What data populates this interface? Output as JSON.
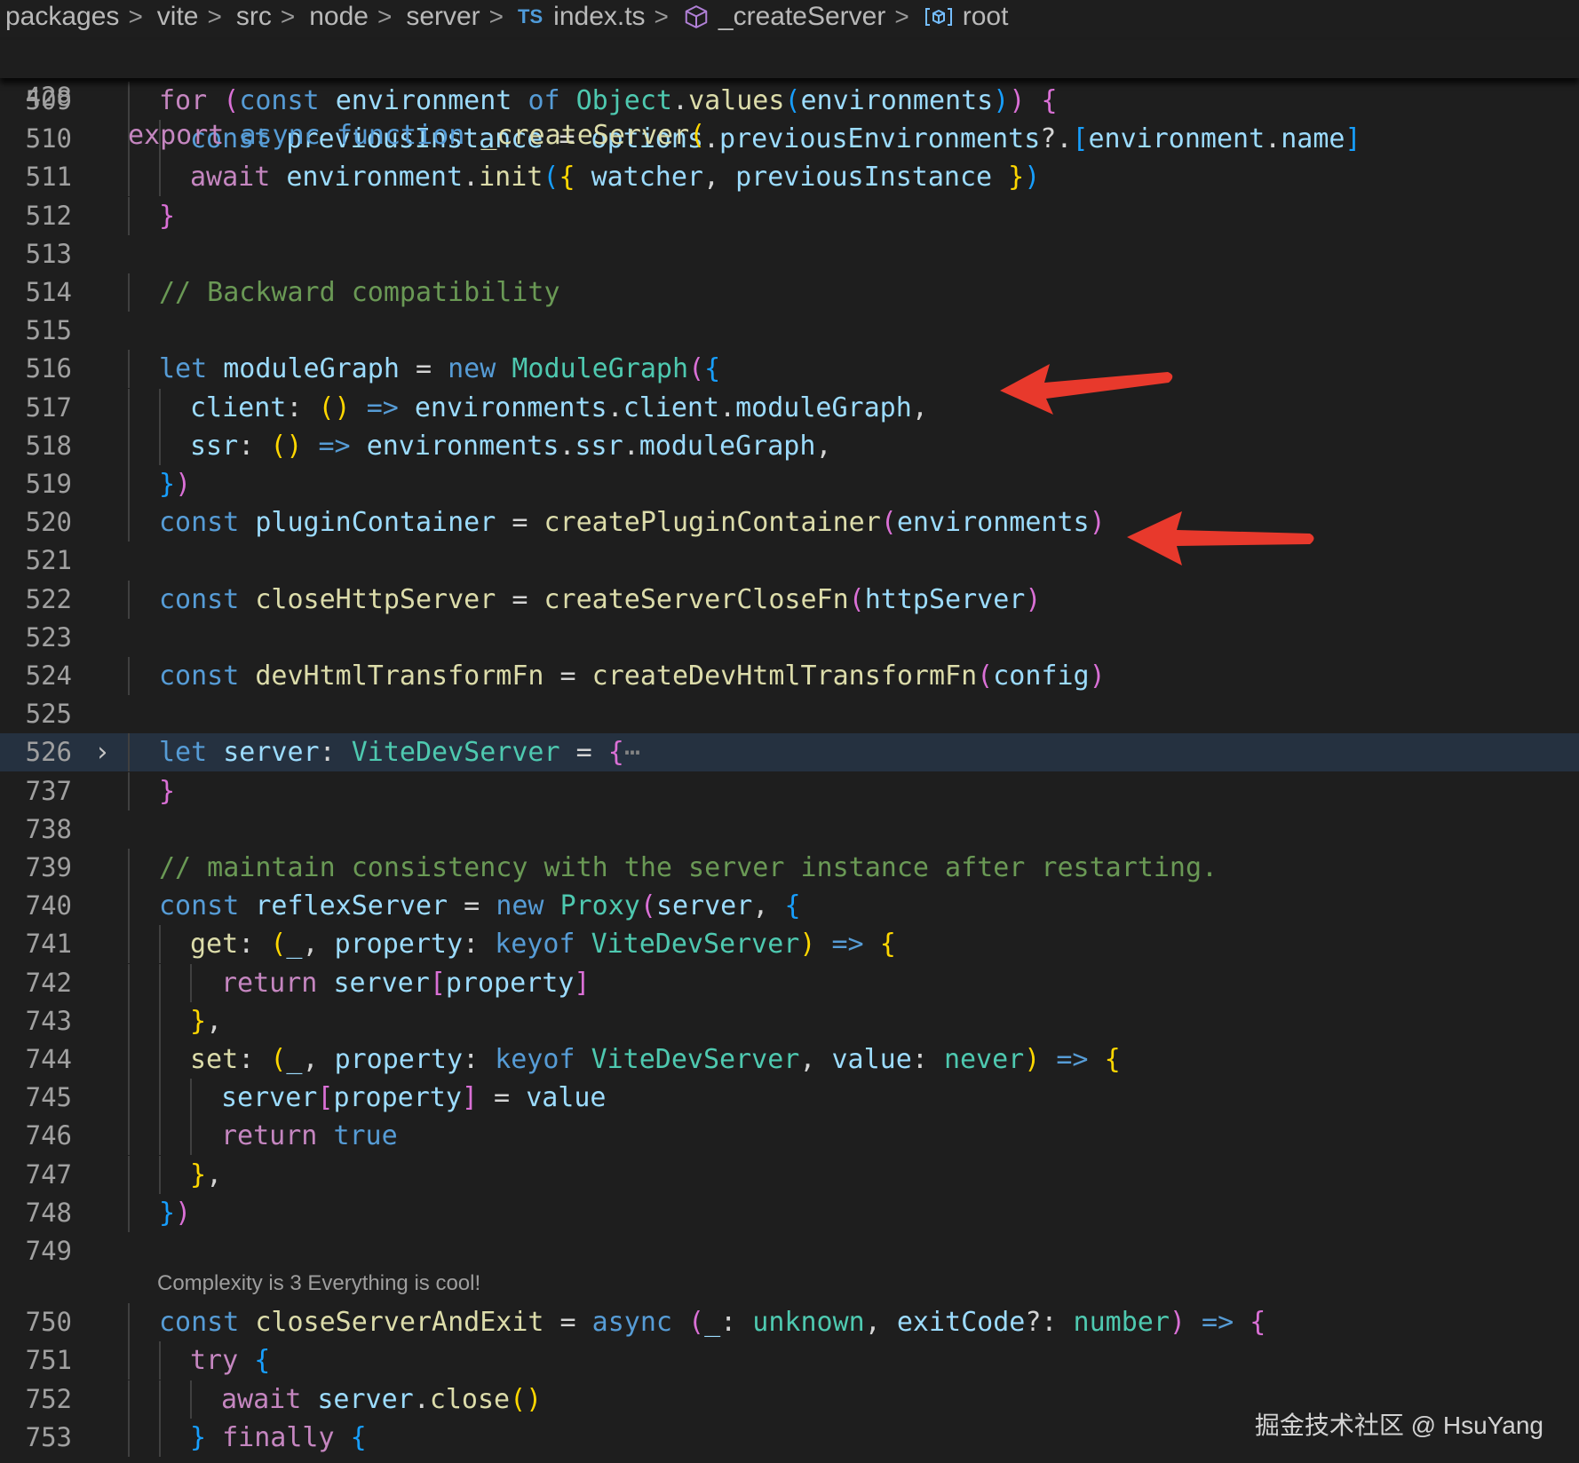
{
  "breadcrumb": {
    "items": [
      "packages",
      "vite",
      "src",
      "node",
      "server",
      "index.ts",
      "_createServer",
      "root"
    ],
    "separator": ">",
    "file_badge": "TS"
  },
  "editor": {
    "sticky_line": {
      "number": "428",
      "tokens": [
        [
          "c",
          "export"
        ],
        [
          "p",
          " "
        ],
        [
          "k",
          "async"
        ],
        [
          "p",
          " "
        ],
        [
          "k",
          "function"
        ],
        [
          "p",
          " "
        ],
        [
          "f",
          "_createServer"
        ],
        [
          "g",
          "("
        ]
      ]
    },
    "lines": [
      {
        "n": "509",
        "indent": 1,
        "t": [
          [
            "c",
            "for"
          ],
          [
            "p",
            " "
          ],
          [
            "h",
            "("
          ],
          [
            "k",
            "const"
          ],
          [
            "p",
            " "
          ],
          [
            "v",
            "environment"
          ],
          [
            "p",
            " "
          ],
          [
            "k",
            "of"
          ],
          [
            "p",
            " "
          ],
          [
            "t",
            "Object"
          ],
          [
            "p",
            "."
          ],
          [
            "f",
            "values"
          ],
          [
            "b",
            "("
          ],
          [
            "v",
            "environments"
          ],
          [
            "b",
            ")"
          ],
          [
            "h",
            ")"
          ],
          [
            "p",
            " "
          ],
          [
            "h",
            "{"
          ]
        ]
      },
      {
        "n": "510",
        "indent": 2,
        "t": [
          [
            "k",
            "const"
          ],
          [
            "p",
            " "
          ],
          [
            "v",
            "previousInstance"
          ],
          [
            "p",
            " = "
          ],
          [
            "v",
            "options"
          ],
          [
            "p",
            "."
          ],
          [
            "v",
            "previousEnvironments"
          ],
          [
            "p",
            "?."
          ],
          [
            "b",
            "["
          ],
          [
            "v",
            "environment"
          ],
          [
            "p",
            "."
          ],
          [
            "v",
            "name"
          ],
          [
            "b",
            "]"
          ]
        ]
      },
      {
        "n": "511",
        "indent": 2,
        "t": [
          [
            "c",
            "await"
          ],
          [
            "p",
            " "
          ],
          [
            "v",
            "environment"
          ],
          [
            "p",
            "."
          ],
          [
            "f",
            "init"
          ],
          [
            "b",
            "("
          ],
          [
            "g",
            "{"
          ],
          [
            "p",
            " "
          ],
          [
            "v",
            "watcher"
          ],
          [
            "p",
            ", "
          ],
          [
            "v",
            "previousInstance"
          ],
          [
            "p",
            " "
          ],
          [
            "g",
            "}"
          ],
          [
            "b",
            ")"
          ]
        ]
      },
      {
        "n": "512",
        "indent": 1,
        "t": [
          [
            "h",
            "}"
          ]
        ]
      },
      {
        "n": "513",
        "indent": 0,
        "t": []
      },
      {
        "n": "514",
        "indent": 1,
        "t": [
          [
            "m",
            "// Backward compatibility"
          ]
        ]
      },
      {
        "n": "515",
        "indent": 0,
        "t": []
      },
      {
        "n": "516",
        "indent": 1,
        "t": [
          [
            "k",
            "let"
          ],
          [
            "p",
            " "
          ],
          [
            "v",
            "moduleGraph"
          ],
          [
            "p",
            " = "
          ],
          [
            "k",
            "new"
          ],
          [
            "p",
            " "
          ],
          [
            "t",
            "ModuleGraph"
          ],
          [
            "h",
            "("
          ],
          [
            "b",
            "{"
          ]
        ]
      },
      {
        "n": "517",
        "indent": 2,
        "t": [
          [
            "v",
            "client"
          ],
          [
            "p",
            ": "
          ],
          [
            "g",
            "()"
          ],
          [
            "p",
            " "
          ],
          [
            "k",
            "=>"
          ],
          [
            "p",
            " "
          ],
          [
            "v",
            "environments"
          ],
          [
            "p",
            "."
          ],
          [
            "v",
            "client"
          ],
          [
            "p",
            "."
          ],
          [
            "v",
            "moduleGraph"
          ],
          [
            "p",
            ","
          ]
        ]
      },
      {
        "n": "518",
        "indent": 2,
        "t": [
          [
            "v",
            "ssr"
          ],
          [
            "p",
            ": "
          ],
          [
            "g",
            "()"
          ],
          [
            "p",
            " "
          ],
          [
            "k",
            "=>"
          ],
          [
            "p",
            " "
          ],
          [
            "v",
            "environments"
          ],
          [
            "p",
            "."
          ],
          [
            "v",
            "ssr"
          ],
          [
            "p",
            "."
          ],
          [
            "v",
            "moduleGraph"
          ],
          [
            "p",
            ","
          ]
        ]
      },
      {
        "n": "519",
        "indent": 1,
        "t": [
          [
            "b",
            "}"
          ],
          [
            "h",
            ")"
          ]
        ]
      },
      {
        "n": "520",
        "indent": 1,
        "t": [
          [
            "k",
            "const"
          ],
          [
            "p",
            " "
          ],
          [
            "v",
            "pluginContainer"
          ],
          [
            "p",
            " = "
          ],
          [
            "f",
            "createPluginContainer"
          ],
          [
            "h",
            "("
          ],
          [
            "v",
            "environments"
          ],
          [
            "h",
            ")"
          ]
        ]
      },
      {
        "n": "521",
        "indent": 0,
        "t": []
      },
      {
        "n": "522",
        "indent": 1,
        "t": [
          [
            "k",
            "const"
          ],
          [
            "p",
            " "
          ],
          [
            "f",
            "closeHttpServer"
          ],
          [
            "p",
            " = "
          ],
          [
            "f",
            "createServerCloseFn"
          ],
          [
            "h",
            "("
          ],
          [
            "v",
            "httpServer"
          ],
          [
            "h",
            ")"
          ]
        ]
      },
      {
        "n": "523",
        "indent": 0,
        "t": []
      },
      {
        "n": "524",
        "indent": 1,
        "t": [
          [
            "k",
            "const"
          ],
          [
            "p",
            " "
          ],
          [
            "f",
            "devHtmlTransformFn"
          ],
          [
            "p",
            " = "
          ],
          [
            "f",
            "createDevHtmlTransformFn"
          ],
          [
            "h",
            "("
          ],
          [
            "v",
            "config"
          ],
          [
            "h",
            ")"
          ]
        ]
      },
      {
        "n": "525",
        "indent": 0,
        "t": []
      },
      {
        "n": "526",
        "indent": 1,
        "folded": true,
        "highlight": true,
        "t": [
          [
            "k",
            "let"
          ],
          [
            "p",
            " "
          ],
          [
            "v",
            "server"
          ],
          [
            "p",
            ": "
          ],
          [
            "t",
            "ViteDevServer"
          ],
          [
            "p",
            " = "
          ],
          [
            "h",
            "{"
          ],
          [
            "x",
            "⋯"
          ]
        ]
      },
      {
        "n": "737",
        "indent": 1,
        "t": [
          [
            "h",
            "}"
          ]
        ]
      },
      {
        "n": "738",
        "indent": 0,
        "t": []
      },
      {
        "n": "739",
        "indent": 1,
        "t": [
          [
            "m",
            "// maintain consistency with the server instance after restarting."
          ]
        ]
      },
      {
        "n": "740",
        "indent": 1,
        "t": [
          [
            "k",
            "const"
          ],
          [
            "p",
            " "
          ],
          [
            "v",
            "reflexServer"
          ],
          [
            "p",
            " = "
          ],
          [
            "k",
            "new"
          ],
          [
            "p",
            " "
          ],
          [
            "t",
            "Proxy"
          ],
          [
            "h",
            "("
          ],
          [
            "v",
            "server"
          ],
          [
            "p",
            ", "
          ],
          [
            "b",
            "{"
          ]
        ]
      },
      {
        "n": "741",
        "indent": 2,
        "t": [
          [
            "f",
            "get"
          ],
          [
            "p",
            ": "
          ],
          [
            "g",
            "("
          ],
          [
            "v",
            "_"
          ],
          [
            "p",
            ", "
          ],
          [
            "v",
            "property"
          ],
          [
            "p",
            ": "
          ],
          [
            "k",
            "keyof"
          ],
          [
            "p",
            " "
          ],
          [
            "t",
            "ViteDevServer"
          ],
          [
            "g",
            ")"
          ],
          [
            "p",
            " "
          ],
          [
            "k",
            "=>"
          ],
          [
            "p",
            " "
          ],
          [
            "g",
            "{"
          ]
        ]
      },
      {
        "n": "742",
        "indent": 3,
        "t": [
          [
            "c",
            "return"
          ],
          [
            "p",
            " "
          ],
          [
            "v",
            "server"
          ],
          [
            "h",
            "["
          ],
          [
            "v",
            "property"
          ],
          [
            "h",
            "]"
          ]
        ]
      },
      {
        "n": "743",
        "indent": 2,
        "t": [
          [
            "g",
            "}"
          ],
          [
            "p",
            ","
          ]
        ]
      },
      {
        "n": "744",
        "indent": 2,
        "t": [
          [
            "f",
            "set"
          ],
          [
            "p",
            ": "
          ],
          [
            "g",
            "("
          ],
          [
            "v",
            "_"
          ],
          [
            "p",
            ", "
          ],
          [
            "v",
            "property"
          ],
          [
            "p",
            ": "
          ],
          [
            "k",
            "keyof"
          ],
          [
            "p",
            " "
          ],
          [
            "t",
            "ViteDevServer"
          ],
          [
            "p",
            ", "
          ],
          [
            "v",
            "value"
          ],
          [
            "p",
            ": "
          ],
          [
            "t",
            "never"
          ],
          [
            "g",
            ")"
          ],
          [
            "p",
            " "
          ],
          [
            "k",
            "=>"
          ],
          [
            "p",
            " "
          ],
          [
            "g",
            "{"
          ]
        ]
      },
      {
        "n": "745",
        "indent": 3,
        "t": [
          [
            "v",
            "server"
          ],
          [
            "h",
            "["
          ],
          [
            "v",
            "property"
          ],
          [
            "h",
            "]"
          ],
          [
            "p",
            " = "
          ],
          [
            "v",
            "value"
          ]
        ]
      },
      {
        "n": "746",
        "indent": 3,
        "t": [
          [
            "c",
            "return"
          ],
          [
            "p",
            " "
          ],
          [
            "k",
            "true"
          ]
        ]
      },
      {
        "n": "747",
        "indent": 2,
        "t": [
          [
            "g",
            "}"
          ],
          [
            "p",
            ","
          ]
        ]
      },
      {
        "n": "748",
        "indent": 1,
        "t": [
          [
            "b",
            "}"
          ],
          [
            "h",
            ")"
          ]
        ]
      },
      {
        "n": "749",
        "indent": 0,
        "t": []
      },
      {
        "n": "750",
        "indent": 1,
        "t": [
          [
            "k",
            "const"
          ],
          [
            "p",
            " "
          ],
          [
            "f",
            "closeServerAndExit"
          ],
          [
            "p",
            " = "
          ],
          [
            "k",
            "async"
          ],
          [
            "p",
            " "
          ],
          [
            "h",
            "("
          ],
          [
            "v",
            "_"
          ],
          [
            "p",
            ": "
          ],
          [
            "t",
            "unknown"
          ],
          [
            "p",
            ", "
          ],
          [
            "v",
            "exitCode"
          ],
          [
            "p",
            "?: "
          ],
          [
            "t",
            "number"
          ],
          [
            "h",
            ")"
          ],
          [
            "p",
            " "
          ],
          [
            "k",
            "=>"
          ],
          [
            "p",
            " "
          ],
          [
            "h",
            "{"
          ]
        ]
      },
      {
        "n": "751",
        "indent": 2,
        "t": [
          [
            "c",
            "try"
          ],
          [
            "p",
            " "
          ],
          [
            "b",
            "{"
          ]
        ]
      },
      {
        "n": "752",
        "indent": 3,
        "t": [
          [
            "c",
            "await"
          ],
          [
            "p",
            " "
          ],
          [
            "v",
            "server"
          ],
          [
            "p",
            "."
          ],
          [
            "f",
            "close"
          ],
          [
            "g",
            "()"
          ]
        ]
      },
      {
        "n": "753",
        "indent": 2,
        "t": [
          [
            "b",
            "}"
          ],
          [
            "p",
            " "
          ],
          [
            "c",
            "finally"
          ],
          [
            "p",
            " "
          ],
          [
            "b",
            "{"
          ]
        ]
      }
    ],
    "codelens": "Complexity is 3 Everything is cool!"
  },
  "annotations": {
    "arrow_color": "#e8392c"
  },
  "watermark": "掘金技术社区 @ HsuYang"
}
